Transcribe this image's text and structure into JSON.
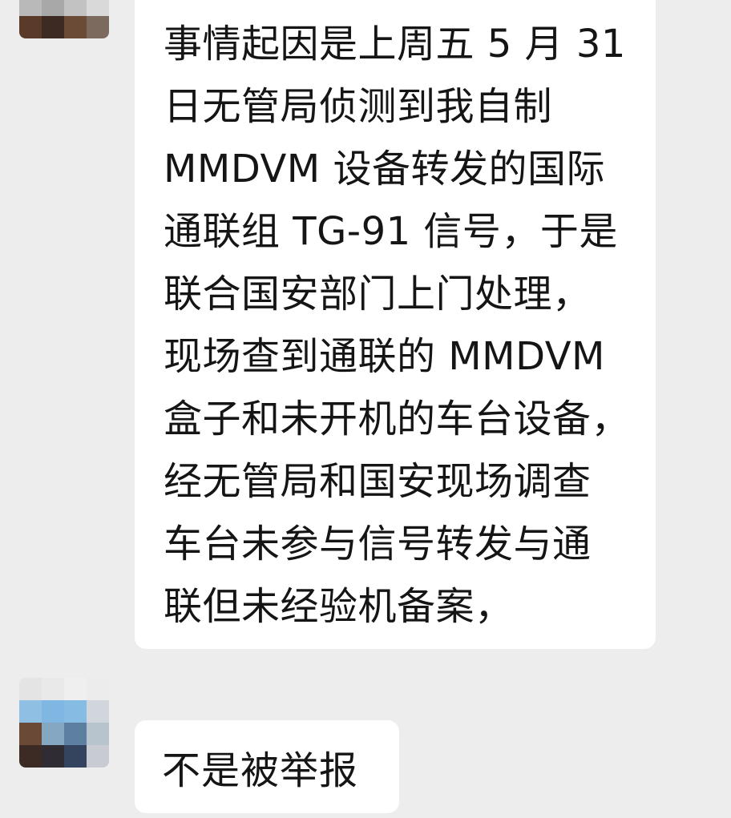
{
  "messages": [
    {
      "sender_avatar": "avatar-pixelated",
      "lines": [
        "事情起因是上周五 5 月 31",
        "日无管局侦测到我自制",
        "MMDVM 设备转发的国际",
        "通联组 TG-91 信号，于是",
        "联合国安部门上门处理，",
        "现场查到通联的 MMDVM",
        "盒子和未开机的车台设备，",
        "经无管局和国安现场调查",
        "车台未参与信号转发与通",
        "联但未经验机备案，"
      ]
    },
    {
      "sender_avatar": "avatar-pixelated",
      "text": "不是被举报"
    }
  ],
  "colors": {
    "background": "#ededed",
    "bubble": "#ffffff",
    "text": "#151515"
  }
}
